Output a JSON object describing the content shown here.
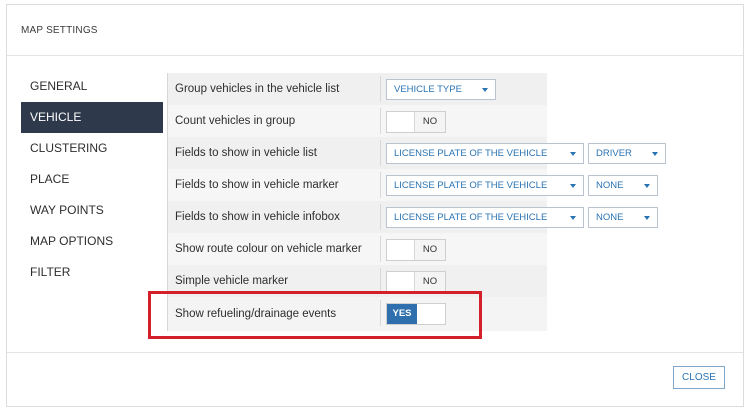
{
  "dialog": {
    "title": "MAP SETTINGS",
    "close_label": "CLOSE"
  },
  "sidebar": {
    "items": [
      {
        "label": "GENERAL",
        "active": false
      },
      {
        "label": "VEHICLE",
        "active": true
      },
      {
        "label": "CLUSTERING",
        "active": false
      },
      {
        "label": "PLACE",
        "active": false
      },
      {
        "label": "WAY POINTS",
        "active": false
      },
      {
        "label": "MAP OPTIONS",
        "active": false
      },
      {
        "label": "FILTER",
        "active": false
      }
    ]
  },
  "settings": {
    "group_vehicles": {
      "label": "Group vehicles in the vehicle list",
      "value": "VEHICLE TYPE"
    },
    "count_vehicles": {
      "label": "Count vehicles in group",
      "value": "NO"
    },
    "fields_list": {
      "label": "Fields to show in vehicle list",
      "value1": "LICENSE PLATE OF THE VEHICLE",
      "value2": "DRIVER"
    },
    "fields_marker": {
      "label": "Fields to show in vehicle marker",
      "value1": "LICENSE PLATE OF THE VEHICLE",
      "value2": "NONE"
    },
    "fields_infobox": {
      "label": "Fields to show in vehicle infobox",
      "value1": "LICENSE PLATE OF THE VEHICLE",
      "value2": "NONE"
    },
    "route_colour": {
      "label": "Show route colour on vehicle marker",
      "value": "NO"
    },
    "simple_marker": {
      "label": "Simple vehicle marker",
      "value": "NO"
    },
    "refueling": {
      "label": "Show refueling/drainage events",
      "value": "YES"
    }
  },
  "colors": {
    "accent": "#2f6fae",
    "sidebar_active": "#2e3a4c",
    "highlight": "#d3202a"
  }
}
